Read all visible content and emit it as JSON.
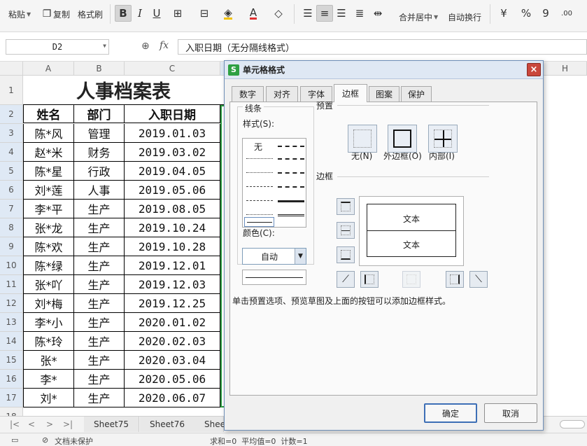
{
  "ribbon": {
    "paste": "粘贴",
    "copy": "复制",
    "format_painter": "格式刷",
    "bold": "B",
    "italic": "I",
    "underline": "U",
    "font_color_glyph": "A",
    "merge_center": "合并居中",
    "wrap_text": "自动换行",
    "percent": "%",
    "comma": "9",
    "currency": "¥"
  },
  "formula_bar": {
    "name_box": "D2",
    "fx": "fx",
    "formula": "入职日期（无分隔线格式）"
  },
  "grid": {
    "columns": [
      "A",
      "B",
      "C",
      "H"
    ],
    "rows": [
      "1",
      "2",
      "3",
      "4",
      "5",
      "6",
      "7",
      "8",
      "9",
      "10",
      "11",
      "12",
      "13",
      "14",
      "15",
      "16",
      "17",
      "18"
    ],
    "title": "人事档案表",
    "headers": [
      "姓名",
      "部门",
      "入职日期"
    ],
    "records": [
      [
        "陈*风",
        "管理",
        "2019.01.03"
      ],
      [
        "赵*米",
        "财务",
        "2019.03.02"
      ],
      [
        "陈*星",
        "行政",
        "2019.04.05"
      ],
      [
        "刘*莲",
        "人事",
        "2019.05.06"
      ],
      [
        "李*平",
        "生产",
        "2019.08.05"
      ],
      [
        "张*龙",
        "生产",
        "2019.10.24"
      ],
      [
        "陈*欢",
        "生产",
        "2019.10.28"
      ],
      [
        "陈*绿",
        "生产",
        "2019.12.01"
      ],
      [
        "张*吖",
        "生产",
        "2019.12.03"
      ],
      [
        "刘*梅",
        "生产",
        "2019.12.25"
      ],
      [
        "李*小",
        "生产",
        "2020.01.02"
      ],
      [
        "陈*玲",
        "生产",
        "2020.02.03"
      ],
      [
        "张*",
        "生产",
        "2020.03.04"
      ],
      [
        "李*",
        "生产",
        "2020.05.06"
      ],
      [
        "刘*",
        "生产",
        "2020.06.07"
      ]
    ]
  },
  "sheet_tabs": [
    "Sheet75",
    "Sheet76",
    "Shee"
  ],
  "status": {
    "doc_protect": "文档未保护",
    "summary": "求和=0  平均值=0  计数=1"
  },
  "dialog": {
    "title": "单元格格式",
    "logo": "S",
    "close": "×",
    "tabs": [
      "数字",
      "对齐",
      "字体",
      "边框",
      "图案",
      "保护"
    ],
    "active_tab": "边框",
    "line_group": "线条",
    "style_label": "样式(S):",
    "style_none": "无",
    "color_label": "颜色(C):",
    "color_value": "自动",
    "preset_group": "预置",
    "preset_none": "无(N)",
    "preset_outline": "外边框(O)",
    "preset_inside": "内部(I)",
    "border_group": "边框",
    "preview_text_1": "文本",
    "preview_text_2": "文本",
    "hint": "单击预置选项、预览草图及上面的按钮可以添加边框样式。",
    "ok": "确定",
    "cancel": "取消"
  },
  "colors": {
    "selection_green": "#2f9e44",
    "dialog_title_bg": "#dfe8f4",
    "close_red": "#c9473c"
  }
}
